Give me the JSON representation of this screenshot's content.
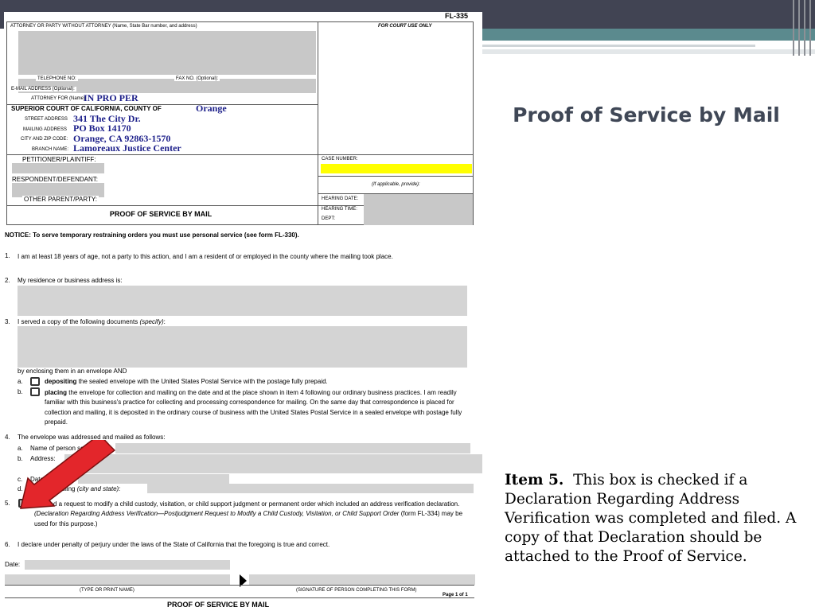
{
  "slide": {
    "title": "Proof of Service by Mail",
    "notes_bold": "Item 5.",
    "notes_text": "This box is checked if a Declaration Regarding Address Verification was completed and filed. A copy of that Declaration should be attached to the Proof of Service."
  },
  "form": {
    "form_number": "FL-335",
    "attorney_header": "ATTORNEY OR PARTY WITHOUT ATTORNEY (Name, State Bar number, and address)",
    "court_use": "FOR COURT USE ONLY",
    "telephone_label": "TELEPHONE NO:",
    "fax_label": "FAX NO. (Optional):",
    "email_label": "E-MAIL ADDRESS (Optional):",
    "attorney_for_label": "ATTORNEY FOR (Name):",
    "attorney_for_value": "IN PRO PER",
    "court_label": "SUPERIOR COURT OF CALIFORNIA, COUNTY OF",
    "county_value": "Orange",
    "street_label": "STREET ADDRESS",
    "street_value": "341 The City Dr.",
    "mailing_label": "MAILING ADDRESS",
    "mailing_value": "PO Box 14170",
    "city_label": "CITY AND ZIP CODE:",
    "city_value": "Orange, CA  92863-1570",
    "branch_label": "BRANCH NAME:",
    "branch_value": "Lamoreaux Justice Center",
    "petitioner_label": "PETITIONER/PLAINTIFF:",
    "respondent_label": "RESPONDENT/DEFENDANT:",
    "other_parent_label": "OTHER PARENT/PARTY:",
    "case_number_label": "CASE NUMBER:",
    "if_applicable": "(If applicable, provide):",
    "hearing_date_label": "HEARING DATE:",
    "hearing_time_label": "HEARING TIME:",
    "dept_label": "DEPT:",
    "form_title": "PROOF OF SERVICE BY MAIL",
    "notice": "NOTICE: To serve temporary restraining orders you must use personal service (see form FL-330).",
    "item1": "I am at least 18 years of age, not a party to this action, and I am a resident of or employed in the county where the mailing took place.",
    "item2": "My residence or business address is:",
    "item3": "I served a copy of the following documents",
    "item3_specify": "(specify)",
    "enclosing": "by enclosing them in an envelope AND",
    "item3a_bold": "depositing",
    "item3a_rest": "the sealed envelope with the United States Postal Service with the postage fully prepaid.",
    "item3b_bold": "placing",
    "item3b_rest": "the envelope for collection and mailing on the date and at the place shown in item 4 following our ordinary business practices. I am readily familiar with this business's practice for collecting and processing correspondence for mailing. On the same day that correspondence is placed for collection and mailing, it is deposited in the ordinary course of business with the United States Postal Service in a sealed envelope with postage fully prepaid.",
    "item4": "The envelope was addressed and mailed as follows:",
    "item4a": "Name of person served:",
    "item4b": "Address:",
    "item4c": "Date mailed:",
    "item4d": "Place of mailing",
    "item4d_italic": "(city and state):",
    "item5_lead": "I served a request to modify a child custody, visitation, or child support judgment or permanent order which included an address verification declaration.",
    "item5_italic": "(Declaration Regarding Address Verification—Postjudgment Request to Modify a Child Custody, Visitation, or Child Support Order",
    "item5_tail": "(form FL-334) may be used for this purpose.)",
    "item6": "I declare under penalty of perjury under the laws of the State of California that the foregoing is true and correct.",
    "date_label": "Date:",
    "type_name_label": "(TYPE OR PRINT NAME)",
    "signature_label": "(SIGNATURE OF PERSON COMPLETING THIS FORM)",
    "page_label": "Page 1 of 1",
    "footer_title": "PROOF OF SERVICE BY MAIL"
  },
  "colors": {
    "topbar": "#414453",
    "accent": "#5b8a8e",
    "title_color": "#3f4756",
    "case_highlight": "#ffff00",
    "arrow": "#e3262b",
    "filled_ink": "#1c1f8a"
  }
}
